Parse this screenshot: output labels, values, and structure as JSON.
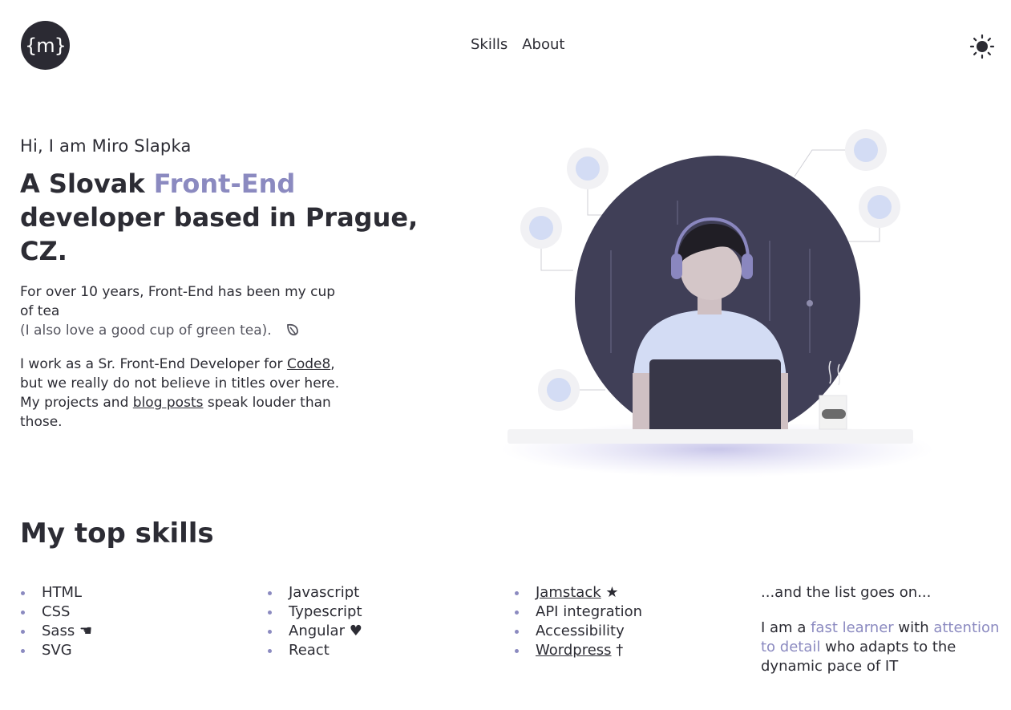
{
  "header": {
    "logo_text": "{m}",
    "nav": [
      {
        "label": "Skills"
      },
      {
        "label": "About"
      }
    ],
    "theme_icon": "sun-icon"
  },
  "hero": {
    "greeting": "Hi, I am Miro Slapka",
    "headline_pre": "A Slovak ",
    "headline_accent": "Front-End",
    "headline_post": " developer based in Prague, CZ.",
    "para1_line1": "For over 10 years, Front-End has been my cup of tea",
    "para1_line2": "(I also love a good cup of green tea).",
    "para2_pre": "I work as a Sr. Front-End Developer for ",
    "para2_link1": "Code8",
    "para2_mid": ", but we really do not believe in titles over here. My projects and ",
    "para2_link2": "blog posts",
    "para2_post": " speak louder than those."
  },
  "skills": {
    "title": "My top skills",
    "col1": [
      {
        "label": "HTML",
        "suffix": ""
      },
      {
        "label": "CSS",
        "suffix": ""
      },
      {
        "label": "Sass",
        "suffix": " ☚"
      },
      {
        "label": "SVG",
        "suffix": ""
      }
    ],
    "col2": [
      {
        "label": "Javascript",
        "suffix": ""
      },
      {
        "label": "Typescript",
        "suffix": ""
      },
      {
        "label": "Angular",
        "suffix": " ♥"
      },
      {
        "label": "React",
        "suffix": ""
      }
    ],
    "col3": [
      {
        "label": "Jamstack",
        "suffix": " ★"
      },
      {
        "label": "API integration",
        "suffix": ""
      },
      {
        "label": "Accessibility",
        "suffix": ""
      },
      {
        "label": "Wordpress",
        "suffix": " †"
      }
    ],
    "aside_line1": "...and the list goes on...",
    "aside_pre": "I am a ",
    "aside_hl1": "fast learner",
    "aside_mid": " with ",
    "aside_hl2": "attention to detail",
    "aside_post": " who adapts to the dynamic pace of IT"
  },
  "colors": {
    "accent": "#8b8ac0",
    "text": "#2c2c34",
    "dark": "#2b2a33",
    "bubble": "#d3dcf4"
  }
}
